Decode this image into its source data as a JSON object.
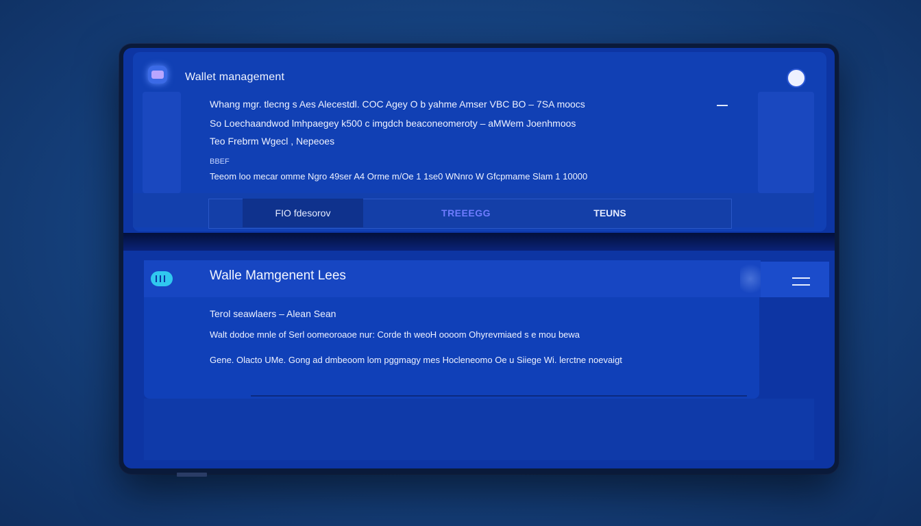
{
  "app": {
    "title": "Wallet management"
  },
  "top_panel": {
    "side_right_line1": "",
    "side_right_line2": "",
    "lines": [
      "Whang mgr. tlecng s Aes  Alecestdl. COC Agey O b yahme Amser VBC BO – 7SA moocs",
      "So Loechaandwod lmhpaegey k500 c imgdch  beaconeomeroty – aMWem Joenhmoos",
      "Teo Frebrm Wgecl , Nepeoes",
      "BBEF",
      "Teeom loo  mecar omme Ngro 49ser A4  Orme m/Oe 1 1se0  WNnro  W Gfcpmame Slam 1 10000"
    ]
  },
  "tabs": [
    {
      "label": "FIO fdesorov"
    },
    {
      "label": "TREEEGG"
    },
    {
      "label": "TEUNS"
    }
  ],
  "bottom_panel": {
    "title": "Walle Mamgenent Lees",
    "lines": [
      "Terol seawlaers  –  Alean Sean",
      "Walt dodoe  mnle of Serl  oomeoroaoe  nur: Corde th weoH  oooom Ohyrevmiaed s e  mou bewa",
      "Gene. Olacto UMe.  Gong ad  dmbeoom  lom pggmagy mes Hocleneomo Oe u Siiege Wi. lerctne noevaigt"
    ]
  },
  "icons": {
    "app": "wallet-app-icon",
    "avatar": "user-avatar-icon",
    "bottom": "wallet-card-icon",
    "menu": "hamburger-menu-icon"
  },
  "colors": {
    "background": "#15407c",
    "screen": "#0d35a3",
    "panel": "#1140b4",
    "accent": "#6e7cff",
    "icon_cyan": "#30c8ef"
  }
}
